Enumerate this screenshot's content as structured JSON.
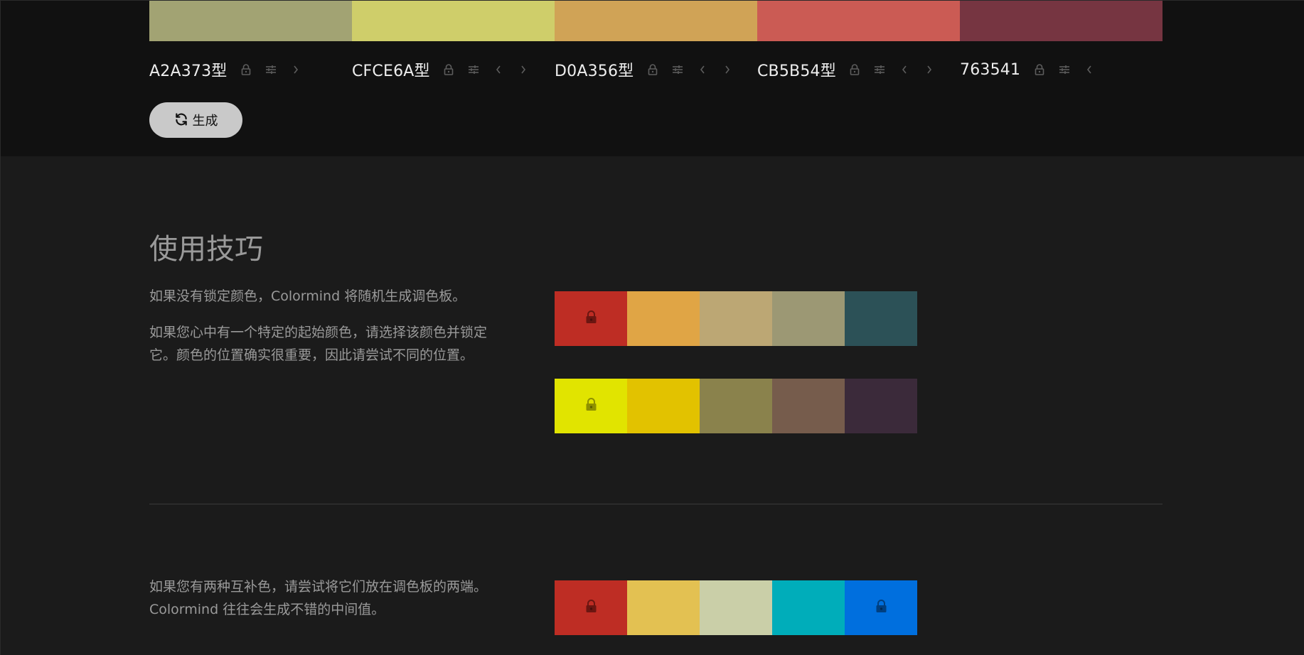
{
  "palette": {
    "swatches": [
      {
        "code": "A2A373型",
        "color": "#A2A373",
        "show_prev": false,
        "show_next": true
      },
      {
        "code": "CFCE6A型",
        "color": "#CFCE6A",
        "show_prev": true,
        "show_next": true
      },
      {
        "code": "D0A356型",
        "color": "#D0A356",
        "show_prev": true,
        "show_next": true
      },
      {
        "code": "CB5B54型",
        "color": "#CB5B54",
        "show_prev": true,
        "show_next": true
      },
      {
        "code": "763541",
        "color": "#763541",
        "show_prev": true,
        "show_next": false
      }
    ],
    "generate_label": "生成"
  },
  "tips": {
    "title": "使用技巧",
    "p1": "如果没有锁定颜色，Colormind 将随机生成调色板。",
    "p2": "如果您心中有一个特定的起始颜色，请选择该颜色并锁定它。颜色的位置确实很重要，因此请尝试不同的位置。",
    "p3": "如果您有两种互补色，请尝试将它们放在调色板的两端。Colormind 往往会生成不错的中间值。",
    "demos": [
      {
        "colors": [
          "#BE2D24",
          "#E0A545",
          "#BCA774",
          "#9C9874",
          "#2C5157"
        ],
        "locked": [
          true,
          false,
          false,
          false,
          false
        ],
        "lock_colors": [
          "#6b1611",
          "",
          "",
          "",
          ""
        ]
      },
      {
        "colors": [
          "#E1E400",
          "#E2C200",
          "#8A824C",
          "#765C4C",
          "#3B2A3A"
        ],
        "locked": [
          true,
          false,
          false,
          false,
          false
        ],
        "lock_colors": [
          "#8e9000",
          "",
          "",
          "",
          ""
        ]
      },
      {
        "colors": [
          "#BE2D24",
          "#E3C152",
          "#CACFA8",
          "#00ADBA",
          "#006FDE"
        ],
        "locked": [
          true,
          false,
          false,
          false,
          true
        ],
        "lock_colors": [
          "#6b1611",
          "",
          "",
          "",
          "#003f80"
        ]
      }
    ]
  }
}
